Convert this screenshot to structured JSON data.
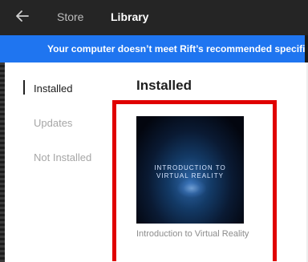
{
  "header": {
    "back_icon": "arrow-left-icon",
    "tabs": [
      {
        "label": "Store"
      },
      {
        "label": "Library",
        "active": true
      }
    ]
  },
  "banner": {
    "text": "Your computer doesn’t meet Rift’s recommended specifications",
    "color": "#1f75f0"
  },
  "sidebar": {
    "items": [
      {
        "label": "Installed",
        "active": true
      },
      {
        "label": "Updates"
      },
      {
        "label": "Not Installed"
      }
    ]
  },
  "main": {
    "heading": "Installed",
    "games": [
      {
        "cover_title_line1": "INTRODUCTION TO",
        "cover_title_line2": "VIRTUAL REALITY",
        "title": "Introduction to Virtual Reality"
      }
    ],
    "highlight_color": "#e00000"
  }
}
